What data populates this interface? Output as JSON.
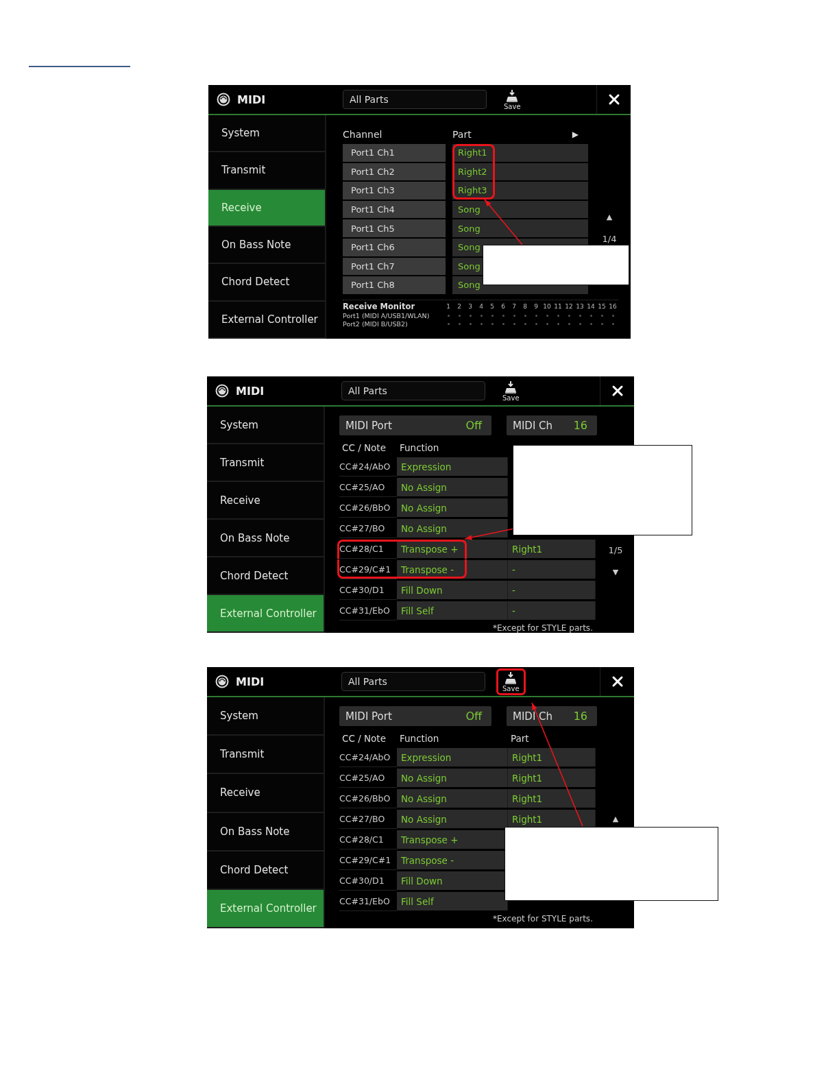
{
  "screens": [
    {
      "kind": "receive",
      "title": "MIDI",
      "dropdown": "All Parts",
      "save_label": "Save",
      "save_highlighted": false,
      "callout": true,
      "menu": [
        {
          "label": "System",
          "selected": false
        },
        {
          "label": "Transmit",
          "selected": false
        },
        {
          "label": "Receive",
          "selected": true
        },
        {
          "label": "On Bass Note",
          "selected": false
        },
        {
          "label": "Chord Detect",
          "selected": false
        },
        {
          "label": "External Controller",
          "selected": false
        }
      ],
      "columns": {
        "channel": "Channel",
        "part": "Part",
        "next": "▶"
      },
      "rows": [
        {
          "channel": "Port1 Ch1",
          "part": "Right1",
          "highlighted": true
        },
        {
          "channel": "Port1 Ch2",
          "part": "Right2",
          "highlighted": true
        },
        {
          "channel": "Port1 Ch3",
          "part": "Right3",
          "highlighted": true
        },
        {
          "channel": "Port1 Ch4",
          "part": "Song",
          "highlighted": false
        },
        {
          "channel": "Port1 Ch5",
          "part": "Song",
          "highlighted": false
        },
        {
          "channel": "Port1 Ch6",
          "part": "Song",
          "highlighted": false
        },
        {
          "channel": "Port1 Ch7",
          "part": "Song",
          "highlighted": false
        },
        {
          "channel": "Port1 Ch8",
          "part": "Song",
          "highlighted": false
        }
      ],
      "pager": {
        "up": "▲",
        "page": "1/4"
      },
      "monitor": {
        "title": "Receive Monitor",
        "channels": [
          "1",
          "2",
          "3",
          "4",
          "5",
          "6",
          "7",
          "8",
          "9",
          "10",
          "11",
          "12",
          "13",
          "14",
          "15",
          "16"
        ],
        "ports": [
          "Port1 (MIDI A/USB1/WLAN)",
          "Port2 (MIDI B/USB2)"
        ]
      }
    },
    {
      "kind": "external",
      "title": "MIDI",
      "dropdown": "All Parts",
      "save_label": "Save",
      "save_highlighted": false,
      "callout": true,
      "menu": [
        {
          "label": "System",
          "selected": false
        },
        {
          "label": "Transmit",
          "selected": false
        },
        {
          "label": "Receive",
          "selected": false
        },
        {
          "label": "On Bass Note",
          "selected": false
        },
        {
          "label": "Chord Detect",
          "selected": false
        },
        {
          "label": "External Controller",
          "selected": true
        }
      ],
      "port": {
        "label": "MIDI Port",
        "value": "Off"
      },
      "channel": {
        "label": "MIDI Ch",
        "value": "16"
      },
      "columns": {
        "cc": "CC / Note",
        "function": "Function"
      },
      "rows": [
        {
          "cc": "CC#24/AbO",
          "function": "Expression",
          "highlighted": false
        },
        {
          "cc": "CC#25/AO",
          "function": "No Assign",
          "highlighted": false
        },
        {
          "cc": "CC#26/BbO",
          "function": "No Assign",
          "highlighted": false
        },
        {
          "cc": "CC#27/BO",
          "function": "No Assign",
          "highlighted": false
        },
        {
          "cc": "CC#28/C1",
          "function": "Transpose +",
          "part": "Right1",
          "highlighted": true
        },
        {
          "cc": "CC#29/C#1",
          "function": "Transpose -",
          "part": "-",
          "highlighted": true
        },
        {
          "cc": "CC#30/D1",
          "function": "Fill Down",
          "part": "-",
          "highlighted": false
        },
        {
          "cc": "CC#31/EbO",
          "function": "Fill Self",
          "part": "-",
          "highlighted": false
        }
      ],
      "pager": {
        "page": "1/5",
        "down": "▼"
      },
      "footnote": "*Except for STYLE parts."
    },
    {
      "kind": "external",
      "title": "MIDI",
      "dropdown": "All Parts",
      "save_label": "Save",
      "save_highlighted": true,
      "callout": true,
      "menu": [
        {
          "label": "System",
          "selected": false
        },
        {
          "label": "Transmit",
          "selected": false
        },
        {
          "label": "Receive",
          "selected": false
        },
        {
          "label": "On Bass Note",
          "selected": false
        },
        {
          "label": "Chord Detect",
          "selected": false
        },
        {
          "label": "External Controller",
          "selected": true
        }
      ],
      "port": {
        "label": "MIDI Port",
        "value": "Off"
      },
      "channel": {
        "label": "MIDI Ch",
        "value": "16"
      },
      "columns": {
        "cc": "CC / Note",
        "function": "Function",
        "part": "Part"
      },
      "rows": [
        {
          "cc": "CC#24/AbO",
          "function": "Expression",
          "part": "Right1",
          "highlighted": false
        },
        {
          "cc": "CC#25/AO",
          "function": "No Assign",
          "part": "Right1",
          "highlighted": false
        },
        {
          "cc": "CC#26/BbO",
          "function": "No Assign",
          "part": "Right1",
          "highlighted": false
        },
        {
          "cc": "CC#27/BO",
          "function": "No Assign",
          "part": "Right1",
          "highlighted": false
        },
        {
          "cc": "CC#28/C1",
          "function": "Transpose +",
          "highlighted": false
        },
        {
          "cc": "CC#29/C#1",
          "function": "Transpose -",
          "highlighted": false
        },
        {
          "cc": "CC#30/D1",
          "function": "Fill Down",
          "highlighted": false
        },
        {
          "cc": "CC#31/EbO",
          "function": "Fill Self",
          "highlighted": false
        }
      ],
      "pager": {
        "up": "▲"
      },
      "footnote": "*Except for STYLE parts."
    }
  ]
}
